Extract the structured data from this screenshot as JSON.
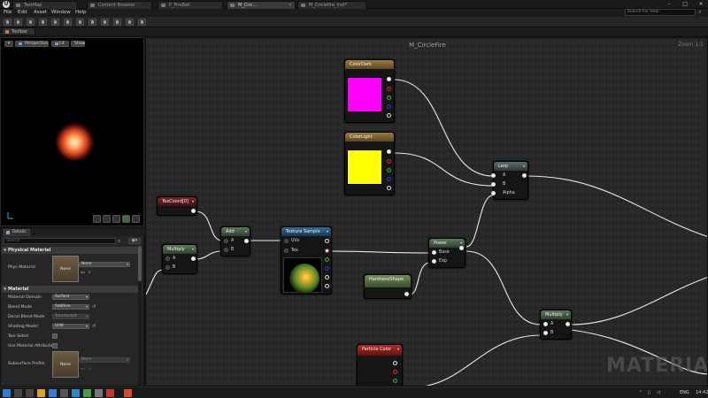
{
  "tabs": [
    {
      "label": "TestMap",
      "active": false
    },
    {
      "label": "Content Browser",
      "active": false
    },
    {
      "label": "P_FireBall",
      "active": false
    },
    {
      "label": "M_Circ...",
      "active": true
    },
    {
      "label": "M_Circlefire_Inst*",
      "active": false
    }
  ],
  "menu": [
    "File",
    "Edit",
    "Asset",
    "Window",
    "Help"
  ],
  "help_search": {
    "placeholder": "Search For Help"
  },
  "window_controls": {
    "minimize": "–",
    "maximize": "□",
    "close": "✕"
  },
  "toolbar_tab": {
    "label": "Toolbar"
  },
  "viewport": {
    "menu_button": "▾",
    "perspective_label": "Perspective",
    "lit_label": "Lit",
    "show_label": "Show"
  },
  "details": {
    "tab_label": "Details",
    "search_placeholder": "Search",
    "eye_icon": "◉▾",
    "physical_material": {
      "header": "Physical Material",
      "phys_material_label": "Phys Material",
      "thumb_label": "None",
      "value": "None"
    },
    "material": {
      "header": "Material",
      "properties": [
        {
          "label": "Material Domain",
          "value": "Surface"
        },
        {
          "label": "Blend Mode",
          "value": "Additive"
        },
        {
          "label": "Decal Blend Mode",
          "value": "Translucent"
        },
        {
          "label": "Shading Model",
          "value": "Unlit"
        }
      ],
      "two_sided_label": "Two Sided",
      "use_material_attributes_label": "Use Material Attributes",
      "subsurface_profile_label": "Subsurface Profile",
      "subsurface_thumb_label": "None",
      "subsurface_value": "None"
    }
  },
  "graph": {
    "title": "M_CircleFire",
    "zoom": "Zoom 1:1",
    "nodes": {
      "color_dark": {
        "title": "ColorDark",
        "color": "#ff00ff"
      },
      "color_light": {
        "title": "ColorLight",
        "color": "#ffff00"
      },
      "tex_coord": {
        "title": "TexCoord[0]"
      },
      "multiply_left": {
        "title": "Multiply",
        "pin_a": "A",
        "pin_b": "B"
      },
      "add": {
        "title": "Add",
        "pin_a": "A",
        "pin_b": "B"
      },
      "texture_sample": {
        "title": "Texture Sample",
        "pin_uvs": "UVs",
        "pin_tex": "Tex"
      },
      "power": {
        "title": "Power",
        "pin_base": "Base",
        "pin_exp": "Exp"
      },
      "hardness_shape": {
        "title": "HardnessShape"
      },
      "lerp": {
        "title": "Lerp",
        "pin_a": "A",
        "pin_b": "B",
        "pin_alpha": "Alpha"
      },
      "multiply_right": {
        "title": "Multiply",
        "pin_a": "A",
        "pin_b": "B"
      },
      "particle_color": {
        "title": "Particle Color"
      }
    }
  },
  "watermark": "MATERIAL",
  "taskbar": {
    "language": "ENG",
    "time": "14:42"
  }
}
